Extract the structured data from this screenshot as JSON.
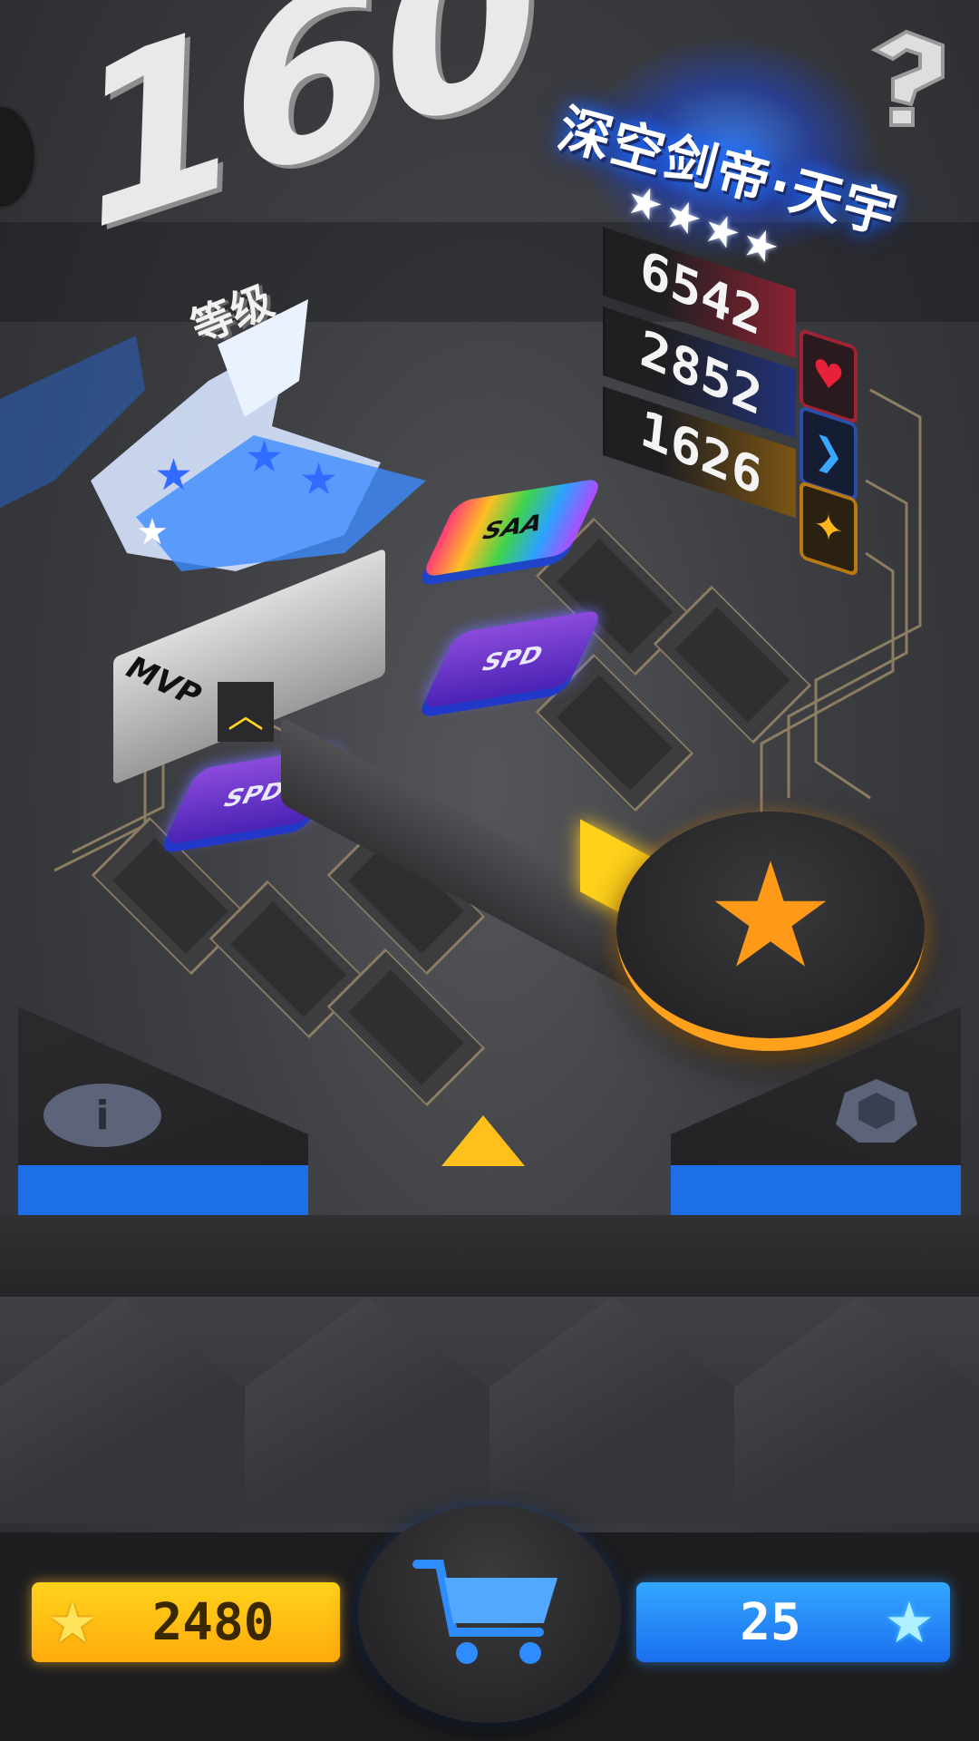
{
  "level": {
    "number": "160",
    "label": "等级"
  },
  "hero": {
    "name": "深空剑帝·天宇",
    "stars": [
      "★",
      "★",
      "★",
      "★"
    ]
  },
  "stats": [
    {
      "value": "6542",
      "icon": "heart-icon"
    },
    {
      "value": "2852",
      "icon": "chevron-right-icon"
    },
    {
      "value": "1626",
      "icon": "sparkle-icon"
    }
  ],
  "board": {
    "mvp_label": "MVP",
    "badges": [
      "SPD",
      "SPD",
      "SAA"
    ]
  },
  "currency": {
    "coins": "2480",
    "gems": "25"
  },
  "colors": {
    "gold": "#ffc01c",
    "blue": "#1d6fe8",
    "orange": "#ff9a19"
  }
}
